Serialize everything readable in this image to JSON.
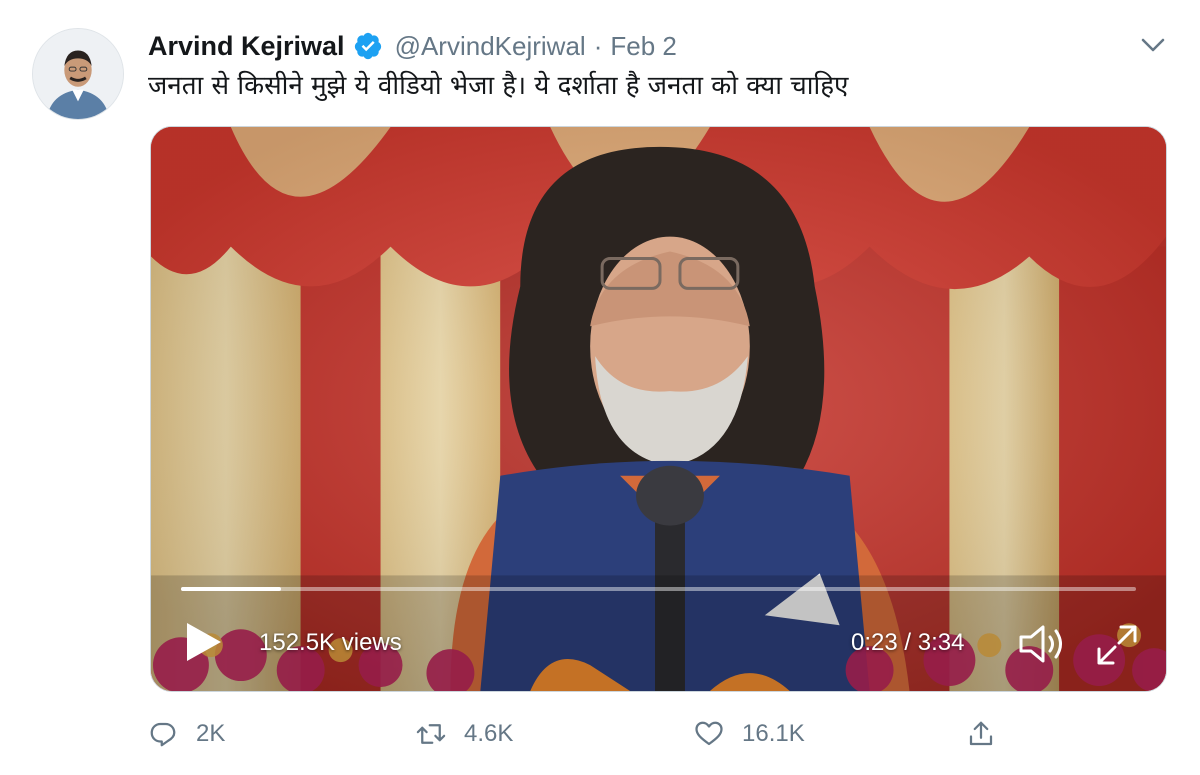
{
  "tweet": {
    "author_name": "Arvind Kejriwal",
    "handle": "@ArvindKejriwal",
    "separator": "·",
    "date": "Feb 2",
    "text": "जनता से किसीने मुझे ये वीडियो भेजा है। ये दर्शाता है जनता को क्या चाहिए",
    "verified": true
  },
  "video": {
    "views": "152.5K views",
    "time": "0:23 / 3:34",
    "progress": 0.105
  },
  "actions": {
    "replies": "2K",
    "retweets": "4.6K",
    "likes": "16.1K"
  },
  "colors": {
    "verified_blue": "#1da1f2",
    "muted_text": "#657786"
  },
  "icons": {
    "avatar": "profile-photo",
    "verified": "verified-badge-icon",
    "caret": "chevron-down-icon",
    "play": "play-icon",
    "volume": "volume-icon",
    "fullscreen": "fullscreen-icon",
    "reply": "reply-icon",
    "retweet": "retweet-icon",
    "like": "heart-icon",
    "share": "share-icon"
  }
}
